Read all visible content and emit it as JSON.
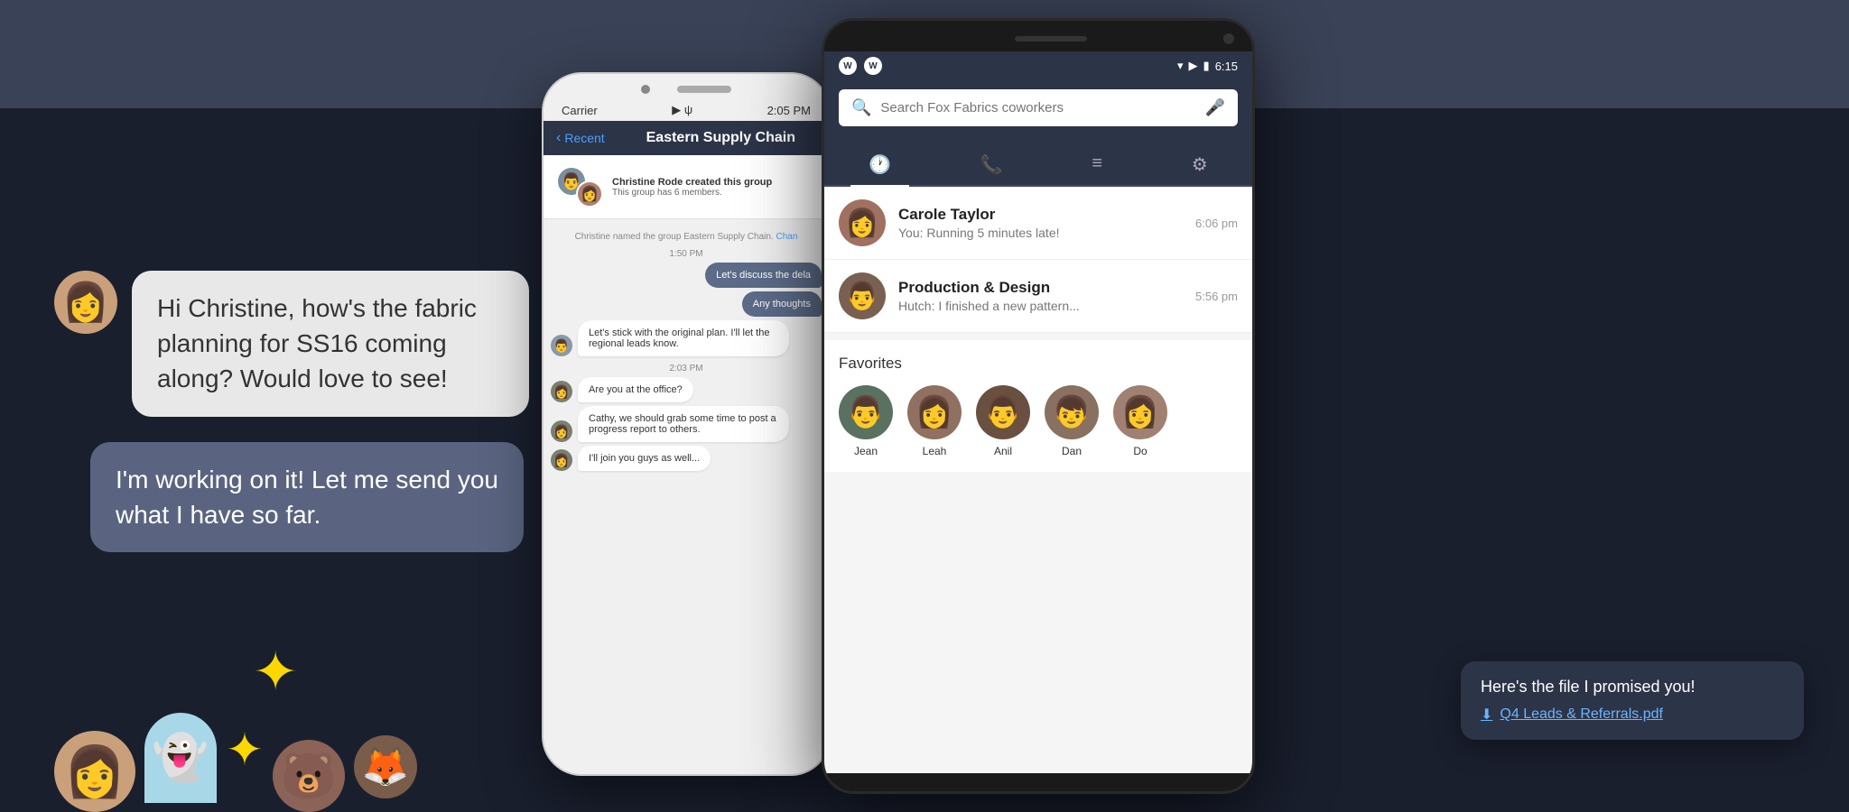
{
  "background": {
    "top_color": "#3a4257",
    "bottom_color": "#1a1f2e"
  },
  "chat_bubbles": {
    "incoming_message": "Hi Christine, how's the fabric planning for SS16 coming along? Would love to see!",
    "outgoing_message": "I'm working on it! Let me send you what I have so far."
  },
  "iphone": {
    "status_carrier": "Carrier",
    "status_wifi": "▸",
    "status_time": "2:05 PM",
    "nav_back": "Recent",
    "nav_title": "Eastern Supply Chain",
    "group_created": "Christine Rode created this group",
    "group_members": "This group has 6 members.",
    "system_message": "Christine named the group Eastern Supply Chain.",
    "system_link": "Chan",
    "time1": "1:50 PM",
    "bubble1": "Let's discuss the dela",
    "bubble2": "Any thoughts",
    "left_msg1": "Let's stick with the original plan. I'll let the regional leads know.",
    "time2": "2:03 PM",
    "left_msg2": "Are you at the office?",
    "left_msg3": "Cathy, we should grab some time to post a progress report to others.",
    "left_msg4": "I'll join you guys as well..."
  },
  "android": {
    "logo1": "W",
    "logo2": "W",
    "status_time": "6:15",
    "search_placeholder": "Search Fox Fabrics coworkers",
    "tabs": [
      "history",
      "phone",
      "list",
      "settings"
    ],
    "conversations": [
      {
        "name": "Carole Taylor",
        "preview": "You: Running 5 minutes late!",
        "time": "6:06 pm",
        "avatar_emoji": "👩"
      },
      {
        "name": "Production & Design",
        "preview": "Hutch: I finished a new pattern...",
        "time": "5:56 pm",
        "avatar_emoji": "👨"
      }
    ],
    "favorites_title": "Favorites",
    "favorites": [
      {
        "name": "Jean",
        "emoji": "👨"
      },
      {
        "name": "Leah",
        "emoji": "👩"
      },
      {
        "name": "Anil",
        "emoji": "👨‍🦱"
      },
      {
        "name": "Dan",
        "emoji": "👦"
      },
      {
        "name": "Do",
        "emoji": "👩"
      }
    ]
  },
  "notification": {
    "message": "Here's the file I promised you!",
    "file_name": "Q4 Leads & Referrals.pdf",
    "download_icon": "⬇"
  },
  "characters": {
    "woman_emoji": "👩",
    "ghost_color": "#a8d8e8",
    "bear1_emoji": "🧸",
    "bear2_emoji": "🦊"
  }
}
